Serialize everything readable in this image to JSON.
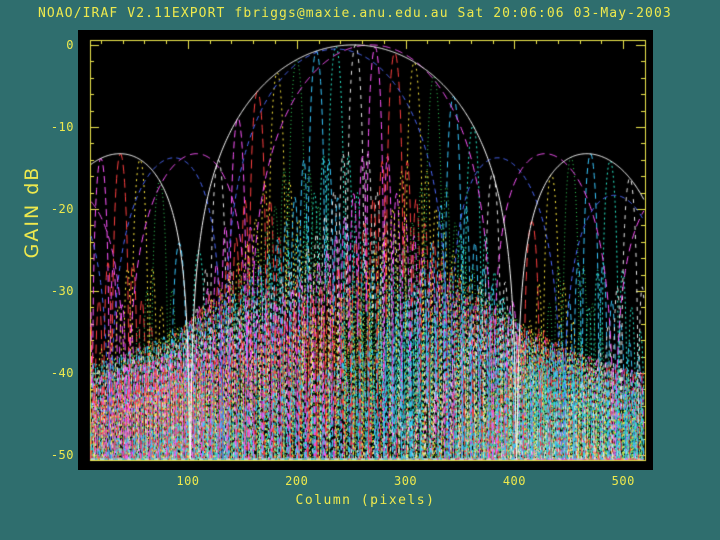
{
  "header": {
    "title": "NOAO/IRAF V2.11EXPORT fbriggs@maxie.anu.edu.au Sat 20:06:06 03-May-2003"
  },
  "colors": {
    "background": "#2f6e6e",
    "plot_background": "#000000",
    "axis": "#efe94d",
    "text": "#efe94d"
  },
  "chart_data": {
    "type": "line",
    "title": "NOAO/IRAF antenna gain pattern plot",
    "xlabel": "Column (pixels)",
    "ylabel": "GAIN dB",
    "xlim": [
      10,
      520
    ],
    "ylim": [
      -50.6,
      0.6
    ],
    "x_ticks": [
      100,
      200,
      300,
      400,
      500
    ],
    "x_minor_step": 20,
    "y_ticks": [
      0,
      -10,
      -20,
      -30,
      -40,
      -50
    ],
    "y_minor_step": 2,
    "floor_db": -50.5,
    "grid": false,
    "legend": "none",
    "series_model": "sinc-squared beam patterns in dB; envelope peaks 0 dB at column 252, first sidelobes near -13 dB at columns ~37 and ~466; narrow colored beams spaced ~18 columns with peak gain following the white envelope",
    "envelopes": [
      {
        "name": "primary-beam-white-solid",
        "color": "#ffffff",
        "dash": [],
        "center": 252,
        "null_halfwidth": 150,
        "peak_db": 0
      },
      {
        "name": "offset-beam-magenta-dashed",
        "color": "#ff55ff",
        "dash": [
          8,
          5
        ],
        "center": 268,
        "null_halfwidth": 112,
        "peak_db": 0
      },
      {
        "name": "offset-beam-blue-dashed",
        "color": "#4d6bff",
        "dash": [
          5,
          4
        ],
        "center": 236,
        "null_halfwidth": 104,
        "peak_db": -0.5
      }
    ],
    "beam_comb": {
      "count": 28,
      "center_start": 20,
      "center_step": 18,
      "null_halfwidth": 8,
      "peak_follows_envelope": 0,
      "colors": [
        "#ff55ff",
        "#ff4040",
        "#ffe93d",
        "#35d05a",
        "#39c8ff",
        "#28e8c8",
        "#e8e8e8"
      ],
      "dashes": [
        [
          7,
          4
        ],
        [
          9,
          5
        ],
        [
          2,
          4
        ],
        [
          1,
          3
        ],
        [
          6,
          4
        ],
        [
          2,
          3
        ],
        [
          4,
          5
        ]
      ]
    }
  }
}
